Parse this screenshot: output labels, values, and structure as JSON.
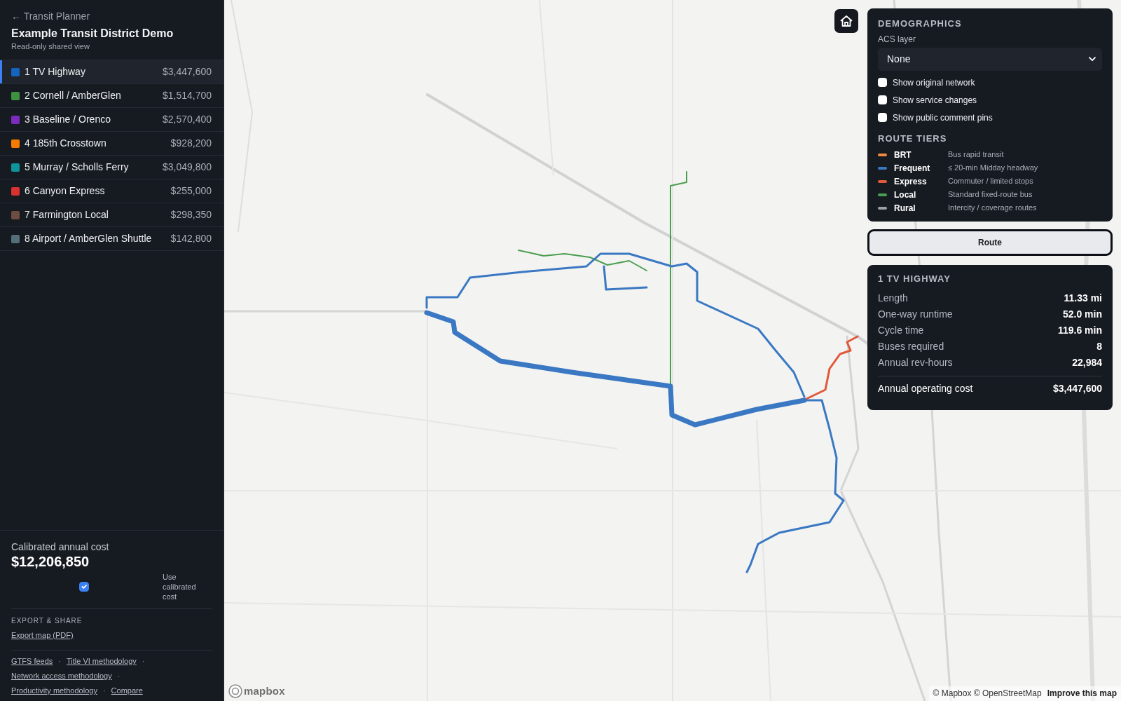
{
  "sidebar": {
    "back_link": "← Transit Planner",
    "title": "Example Transit District Demo",
    "subtitle": "Read-only shared view",
    "routes": [
      {
        "name": "1 TV Highway",
        "cost": "$3,447,600",
        "color": "#1565c0",
        "selected": true
      },
      {
        "name": "2 Cornell / AmberGlen",
        "cost": "$1,514,700",
        "color": "#3f9142",
        "selected": false
      },
      {
        "name": "3 Baseline / Orenco",
        "cost": "$2,570,400",
        "color": "#7b2cbf",
        "selected": false
      },
      {
        "name": "4 185th Crosstown",
        "cost": "$928,200",
        "color": "#f57c00",
        "selected": false
      },
      {
        "name": "5 Murray / Scholls Ferry",
        "cost": "$3,049,800",
        "color": "#0f949c",
        "selected": false
      },
      {
        "name": "6 Canyon Express",
        "cost": "$255,000",
        "color": "#d93030",
        "selected": false
      },
      {
        "name": "7 Farmington Local",
        "cost": "$298,350",
        "color": "#6d4c41",
        "selected": false
      },
      {
        "name": "8 Airport / AmberGlen Shuttle",
        "cost": "$142,800",
        "color": "#546e7a",
        "selected": false
      }
    ],
    "calibrated": {
      "label": "Calibrated annual cost",
      "value": "$12,206,850",
      "checkbox_label": "Use calibrated cost",
      "checked": true
    },
    "export": {
      "heading": "EXPORT & SHARE",
      "link": "Export map (PDF)"
    },
    "footer_links": [
      {
        "label": "GTFS feeds",
        "separator": "·"
      },
      {
        "label": "Title VI methodology",
        "separator": "·"
      },
      {
        "label": "Network access methodology",
        "separator": "·"
      },
      {
        "label": "Productivity methodology",
        "separator": "·"
      },
      {
        "label": "Compare"
      }
    ]
  },
  "demographics": {
    "heading": "DEMOGRAPHICS",
    "select_label": "ACS layer",
    "select_value": "None",
    "toggles": [
      {
        "label": "Show original network",
        "checked": false
      },
      {
        "label": "Show service changes",
        "checked": false
      },
      {
        "label": "Show public comment pins",
        "checked": false
      }
    ],
    "tiers_heading": "ROUTE TIERS",
    "tiers": [
      {
        "name": "BRT",
        "description": "Bus rapid transit",
        "color": "#f0883e"
      },
      {
        "name": "Frequent",
        "description": "≤ 20-min Midday headway",
        "color": "#3a78c3"
      },
      {
        "name": "Express",
        "description": "Commuter / limited stops",
        "color": "#e0593a"
      },
      {
        "name": "Local",
        "description": "Standard fixed-route bus",
        "color": "#4a9e4f"
      },
      {
        "name": "Rural",
        "description": "Intercity / coverage routes",
        "color": "#9aa0a6"
      }
    ]
  },
  "route_button": "Route",
  "route_info": {
    "title": "1 TV HIGHWAY",
    "stats": [
      {
        "label": "Length",
        "value": "11.33 mi"
      },
      {
        "label": "One-way runtime",
        "value": "52.0 min"
      },
      {
        "label": "Cycle time",
        "value": "119.6 min"
      },
      {
        "label": "Buses required",
        "value": "8"
      },
      {
        "label": "Annual rev-hours",
        "value": "22,984"
      }
    ],
    "total": {
      "label": "Annual operating cost",
      "value": "$3,447,600"
    }
  },
  "map": {
    "logo_text": "mapbox",
    "attribution": "© Mapbox © OpenStreetMap",
    "improve_link": "Improve this map"
  }
}
